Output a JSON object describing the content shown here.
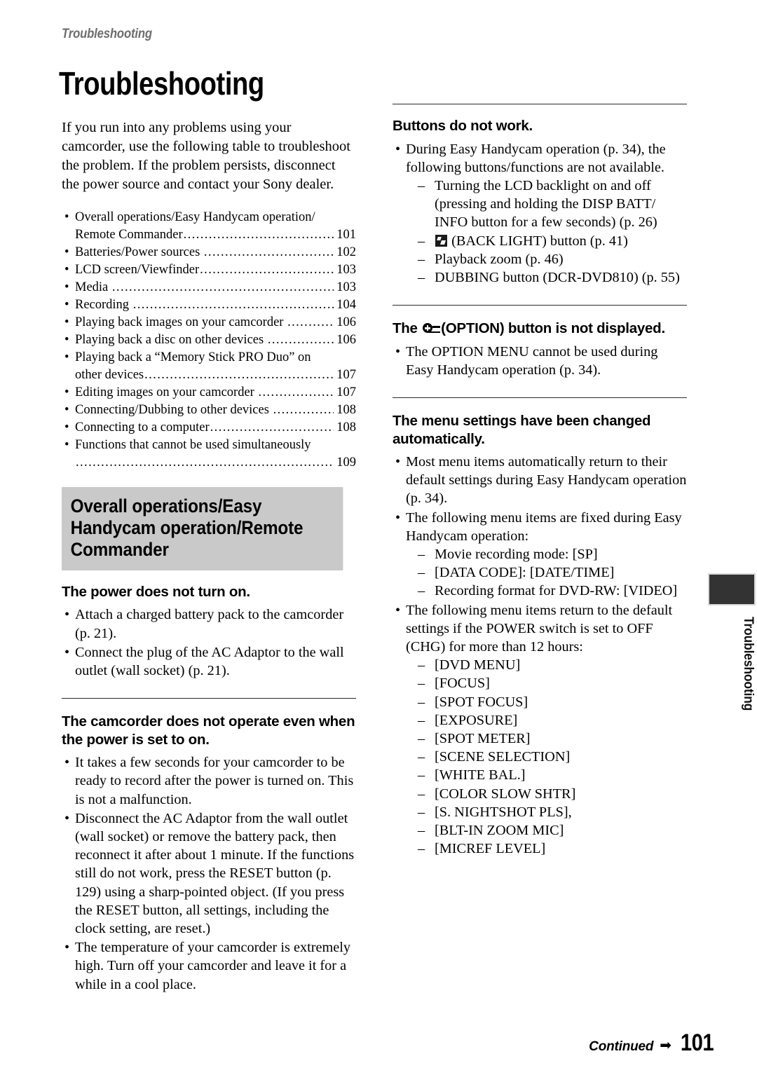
{
  "running_head": "Troubleshooting",
  "page_title": "Troubleshooting",
  "intro": "If you run into any problems using your camcorder, use the following table to troubleshoot the problem. If the problem persists, disconnect the power source and contact your Sony dealer.",
  "toc": [
    {
      "label": "Overall operations/Easy Handycam operation/",
      "label2": "Remote Commander",
      "page": "101"
    },
    {
      "label": "Batteries/Power sources ",
      "page": "102"
    },
    {
      "label": "LCD screen/Viewfinder",
      "page": "103"
    },
    {
      "label": "Media ",
      "page": "103"
    },
    {
      "label": "Recording ",
      "page": "104"
    },
    {
      "label": "Playing back images on your camcorder ",
      "page": "106"
    },
    {
      "label": "Playing back a disc on other devices ",
      "page": "106"
    },
    {
      "label": "Playing back a “Memory Stick PRO Duo” on",
      "label2": "other devices",
      "page": "107"
    },
    {
      "label": "Editing images on your camcorder ",
      "page": "107"
    },
    {
      "label": "Connecting/Dubbing to other devices ",
      "page": "108"
    },
    {
      "label": "Connecting to a computer",
      "page": "108"
    },
    {
      "label": "Functions that cannot be used simultaneously",
      "label2": "",
      "page": "109"
    }
  ],
  "banner": "Overall operations/Easy Handycam operation/Remote Commander",
  "sections": {
    "power_not_on": {
      "heading": "The power does not turn on.",
      "bullets": [
        "Attach a charged battery pack to the camcorder (p. 21).",
        "Connect the plug of the AC Adaptor to the wall outlet (wall socket) (p. 21)."
      ]
    },
    "not_operate": {
      "heading": "The camcorder does not operate even when the power is set to on.",
      "bullets": [
        "It takes a few seconds for your camcorder to be ready to record after the power is turned on. This is not a malfunction.",
        "Disconnect the AC Adaptor from the wall outlet (wall socket) or remove the battery pack, then reconnect it after about 1 minute. If the functions still do not work, press the RESET button (p. 129) using a sharp-pointed object. (If you press the RESET button, all settings, including the clock setting, are reset.)",
        "The temperature of your camcorder is extremely high. Turn off your camcorder and leave it for a while in a cool place."
      ]
    },
    "buttons_not_work": {
      "heading": "Buttons do not work.",
      "bullet_intro": "During Easy Handycam operation (p. 34), the following buttons/functions are not available.",
      "dashes": [
        "Turning the LCD backlight on and off (pressing and holding the DISP BATT/ INFO button for a few seconds) (p. 26)",
        "(BACK LIGHT) button (p. 41)",
        "Playback zoom (p. 46)",
        "DUBBING button (DCR-DVD810) (p. 55)"
      ]
    },
    "option_not_displayed": {
      "heading_before": "The ",
      "heading_after": "(OPTION) button is not displayed.",
      "bullets": [
        "The OPTION MENU cannot be used during Easy Handycam operation (p. 34)."
      ]
    },
    "menu_changed": {
      "heading": "The menu settings have been changed automatically.",
      "bullet1": "Most menu items automatically return to their default settings during Easy Handycam operation (p. 34).",
      "bullet2": "The following menu items are fixed during Easy Handycam operation:",
      "fixed_items": [
        "Movie recording mode: [SP]",
        "[DATA CODE]: [DATE/TIME]",
        "Recording format for DVD-RW: [VIDEO]"
      ],
      "bullet3": "The following menu items return to the default settings if the POWER switch is set to OFF (CHG) for more than 12 hours:",
      "default_items": [
        "[DVD MENU]",
        "[FOCUS]",
        "[SPOT FOCUS]",
        "[EXPOSURE]",
        "[SPOT METER]",
        "[SCENE SELECTION]",
        "[WHITE BAL.]",
        "[COLOR SLOW SHTR]",
        "[S. NIGHTSHOT PLS],",
        "[BLT-IN ZOOM MIC]",
        "[MICREF LEVEL]"
      ]
    }
  },
  "thumb_tab_label": "Troubleshooting",
  "footer": {
    "continued": "Continued",
    "arrow": "➡",
    "page_number": "101"
  },
  "bullet_char": "•",
  "dash_char": "–",
  "dot_leader": "..........................................................................................................",
  "colors": {
    "banner_bg": "#c9c9c9",
    "running_head": "#6e6e6e",
    "thumb_tab": "#333333"
  }
}
